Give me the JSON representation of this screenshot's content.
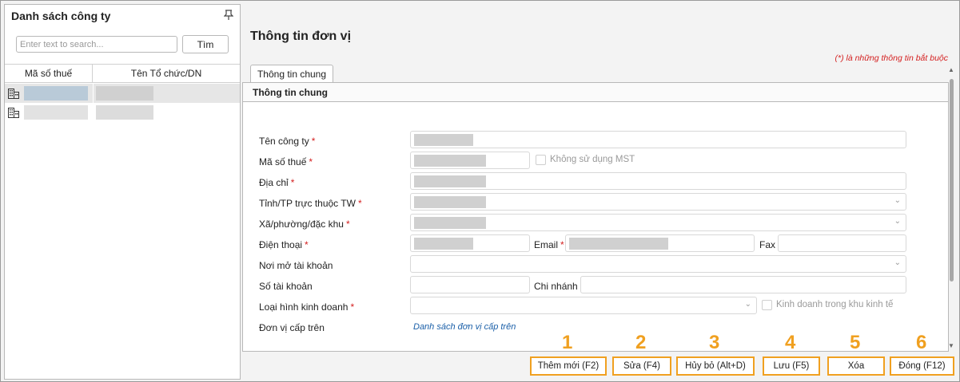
{
  "left_panel": {
    "title": "Danh sách công ty",
    "search_placeholder": "Enter text to search...",
    "search_button": "Tìm",
    "columns": [
      "Mã số thuế",
      "Tên Tổ chức/DN"
    ]
  },
  "main": {
    "title": "Thông tin đơn vị",
    "required_note": "(*)  là những thông tin bắt buộc",
    "tab_label": "Thông tin chung",
    "section_title": "Thông tin chung",
    "fields": {
      "company_name": "Tên công ty",
      "tax_code": "Mã số thuế",
      "no_tax_code": "Không sử dụng MST",
      "address": "Địa chỉ",
      "province": "Tỉnh/TP trực thuộc TW",
      "ward": "Xã/phường/đặc khu",
      "phone": "Điện thoại",
      "email": "Email",
      "fax": "Fax",
      "bank_place": "Nơi mở tài khoản",
      "account_no": "Số tài khoản",
      "branch": "Chi nhánh",
      "business_type": "Loại hình kinh doanh",
      "economic_zone": "Kinh doanh trong khu kinh tế",
      "parent_unit": "Đơn vị cấp trên",
      "parent_link": "Danh sách đơn vị cấp trên"
    },
    "required_mark": "*"
  },
  "buttons": [
    {
      "num": "1",
      "label": "Thêm mới (F2)"
    },
    {
      "num": "2",
      "label": "Sửa (F4)"
    },
    {
      "num": "3",
      "label": "Hủy bỏ (Alt+D)"
    },
    {
      "num": "4",
      "label": "Lưu (F5)"
    },
    {
      "num": "5",
      "label": "Xóa"
    },
    {
      "num": "6",
      "label": "Đóng (F12)"
    }
  ],
  "colors": {
    "required": "#d42020",
    "highlight": "#f0a020",
    "link": "#1a5fa8"
  }
}
